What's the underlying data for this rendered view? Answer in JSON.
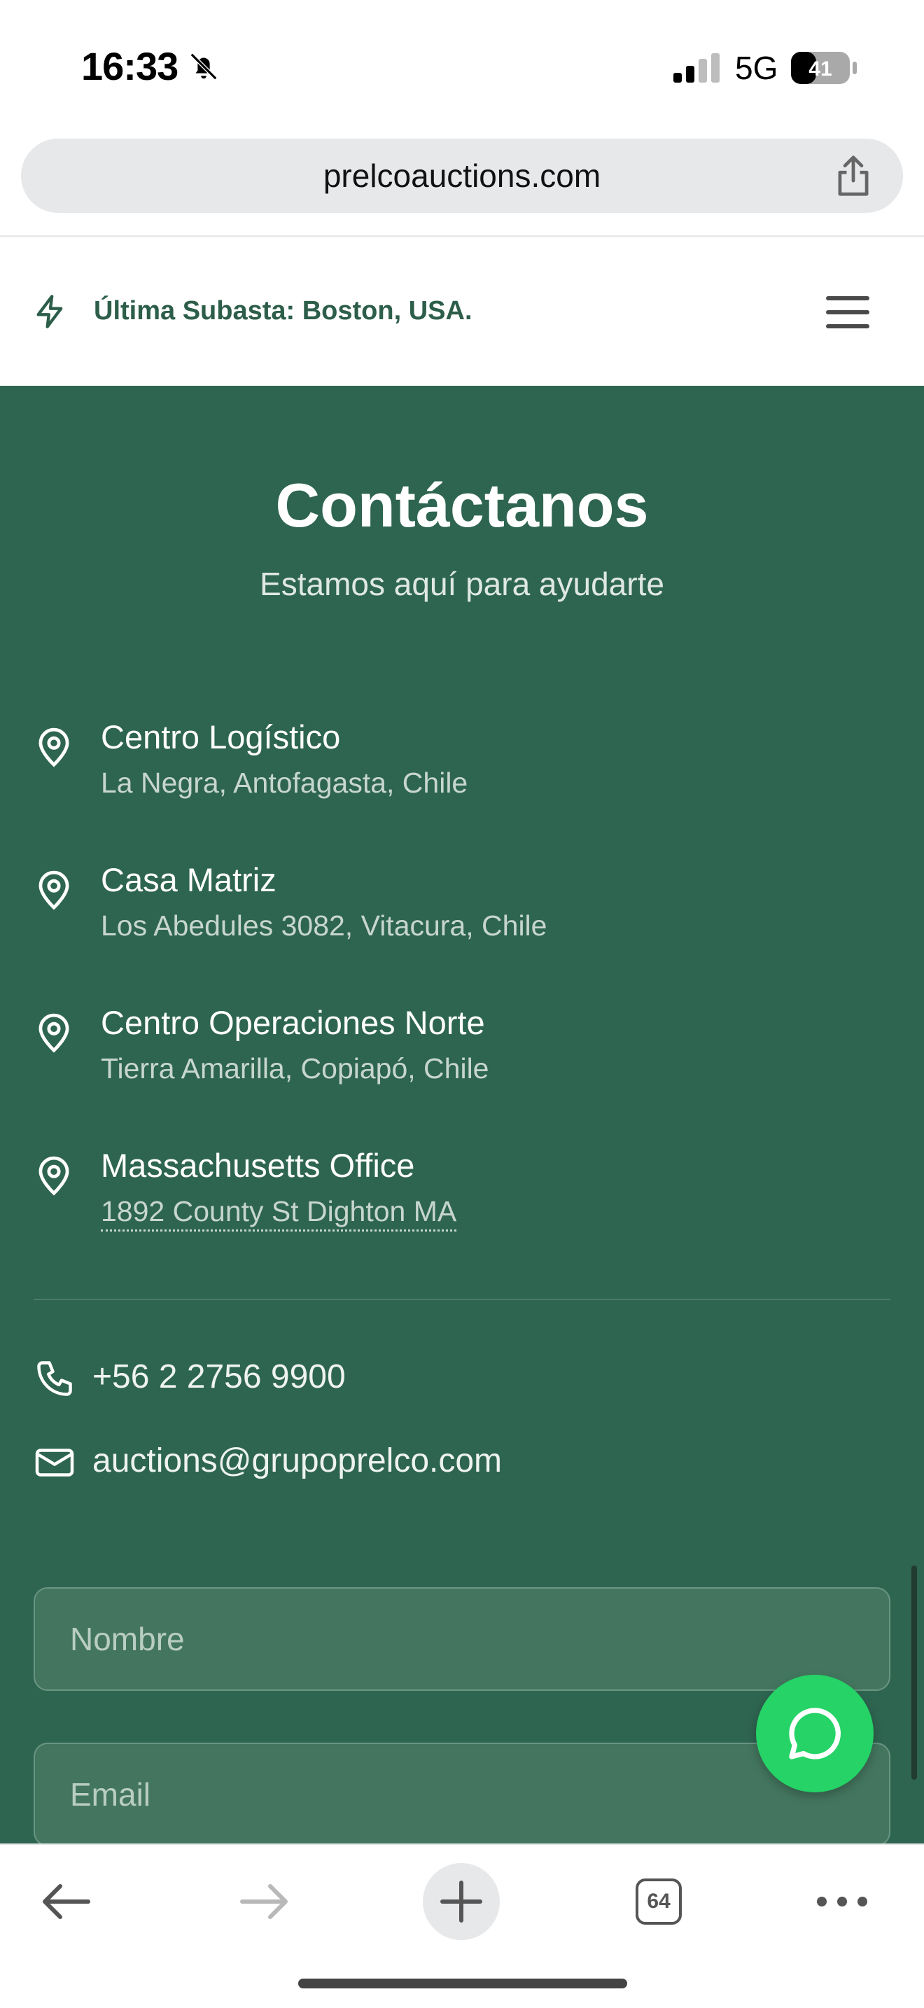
{
  "status_bar": {
    "time": "16:33",
    "network": "5G",
    "battery": "41"
  },
  "browser": {
    "url": "prelcoauctions.com",
    "tabs_count": "64"
  },
  "announcement": {
    "text": "Última Subasta: Boston, USA."
  },
  "contact": {
    "title": "Contáctanos",
    "subtitle": "Estamos aquí para ayudarte",
    "locations": [
      {
        "name": "Centro Logístico",
        "address": "La Negra, Antofagasta, Chile"
      },
      {
        "name": "Casa Matriz",
        "address": "Los Abedules 3082, Vitacura, Chile"
      },
      {
        "name": "Centro Operaciones Norte",
        "address": "Tierra Amarilla, Copiapó, Chile"
      },
      {
        "name": "Massachusetts Office",
        "address": "1892 County St Dighton MA"
      }
    ],
    "phone": "+56 2 2756 9900",
    "email": "auctions@grupoprelco.com",
    "form": {
      "name_placeholder": "Nombre",
      "email_placeholder": "Email"
    }
  },
  "colors": {
    "section_bg": "#2e6550",
    "accent": "#2d5e4a",
    "whatsapp": "#25d366"
  },
  "icons": {
    "announcement": "lightning-icon",
    "menu": "hamburger-menu-icon",
    "location": "map-pin-icon",
    "phone": "phone-icon",
    "email": "mail-icon",
    "chat": "chat-bubble-icon"
  }
}
